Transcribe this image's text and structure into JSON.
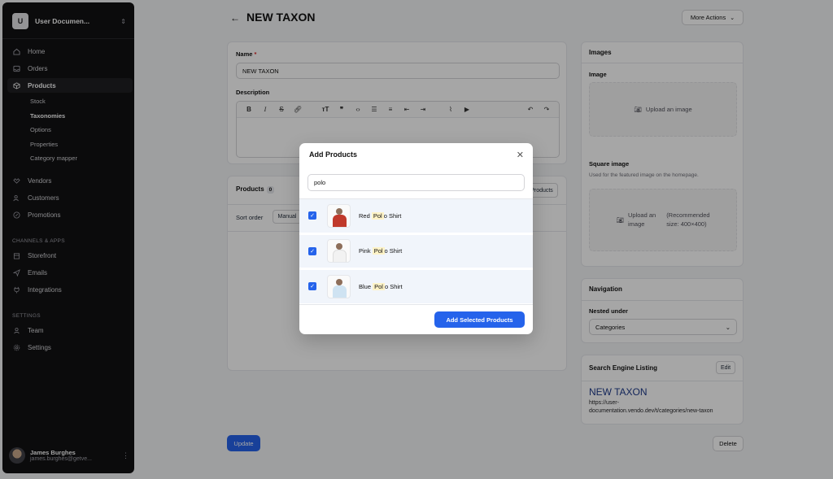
{
  "sidebar": {
    "store_initial": "U",
    "store_name": "User Documen...",
    "main_nav": [
      {
        "label": "Home",
        "icon": "home-icon"
      },
      {
        "label": "Orders",
        "icon": "inbox-icon"
      },
      {
        "label": "Products",
        "icon": "box-icon"
      }
    ],
    "product_sub": [
      {
        "label": "Stock"
      },
      {
        "label": "Taxonomies"
      },
      {
        "label": "Options"
      },
      {
        "label": "Properties"
      },
      {
        "label": "Category mapper"
      }
    ],
    "more_nav": [
      {
        "label": "Vendors",
        "icon": "handshake-icon"
      },
      {
        "label": "Customers",
        "icon": "users-icon"
      },
      {
        "label": "Promotions",
        "icon": "discount-icon"
      }
    ],
    "channels_heading": "CHANNELS & APPS",
    "channels": [
      {
        "label": "Storefront",
        "icon": "store-icon"
      },
      {
        "label": "Emails",
        "icon": "send-icon"
      },
      {
        "label": "Integrations",
        "icon": "plug-icon"
      }
    ],
    "settings_heading": "SETTINGS",
    "settings": [
      {
        "label": "Team",
        "icon": "team-icon"
      },
      {
        "label": "Settings",
        "icon": "gear-icon"
      }
    ],
    "user": {
      "name": "James Burghes",
      "email": "james.burghes@getve..."
    }
  },
  "header": {
    "title": "NEW TAXON",
    "more_actions": "More Actions"
  },
  "form": {
    "name_label": "Name",
    "name_required": "*",
    "name_value": "NEW TAXON",
    "description_label": "Description"
  },
  "products_card": {
    "title": "Products",
    "count": "0",
    "add_button": "Products",
    "sort_label": "Sort order",
    "sort_value": "Manual"
  },
  "images_card": {
    "title": "Images",
    "image_label": "Image",
    "upload_label": "Upload an image",
    "square_label": "Square image",
    "square_help": "Used for the featured image on the homepage.",
    "square_upload_line1": "Upload an",
    "square_upload_line2": "image",
    "square_rec_line1": "(Recommended",
    "square_rec_line2": "size: 400×400)"
  },
  "navigation_card": {
    "title": "Navigation",
    "nested_label": "Nested under",
    "nested_value": "Categories"
  },
  "seo_card": {
    "title": "Search Engine Listing",
    "edit": "Edit",
    "seo_title": "NEW TAXON",
    "url_line1": "https://user-",
    "url_line2": "documentation.vendo.dev/t/categories/new-taxon"
  },
  "footer": {
    "update": "Update",
    "delete": "Delete"
  },
  "modal": {
    "title": "Add Products",
    "search_value": "polo",
    "products": [
      {
        "before": "Red ",
        "match": "Pol",
        "after": "o Shirt",
        "checked": true,
        "shirt_color": "#c0392b"
      },
      {
        "before": "Pink ",
        "match": "Pol",
        "after": "o Shirt",
        "checked": true,
        "shirt_color": "#f2f2f2"
      },
      {
        "before": "Blue ",
        "match": "Pol",
        "after": "o Shirt",
        "checked": true,
        "shirt_color": "#cfe3f2"
      }
    ],
    "add_button": "Add Selected Products"
  },
  "colors": {
    "accent": "#2563eb",
    "sidebar_bg": "#111113",
    "highlight": "#fef3c7"
  }
}
